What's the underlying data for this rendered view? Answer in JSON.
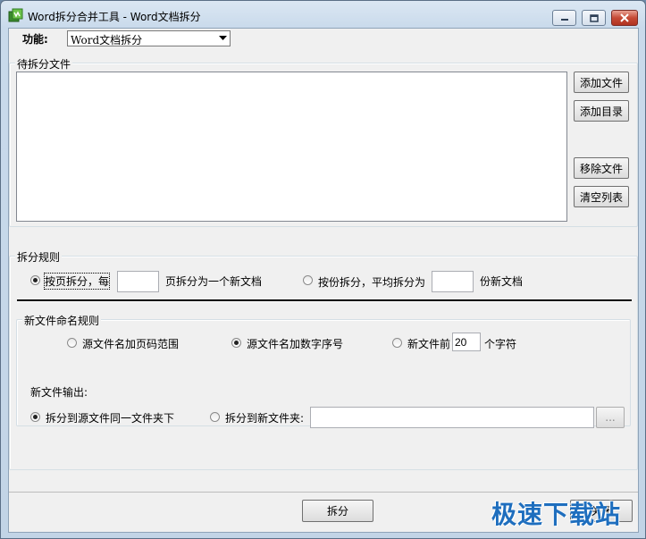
{
  "window": {
    "title": "Word拆分合并工具 - Word文档拆分"
  },
  "function_bar": {
    "label": "功能:",
    "selected": "Word文档拆分"
  },
  "files_group": {
    "title": "待拆分文件",
    "buttons": {
      "add_file": "添加文件",
      "add_dir": "添加目录",
      "remove_file": "移除文件",
      "clear_list": "清空列表"
    }
  },
  "split_rules": {
    "title": "拆分规则",
    "by_page_label": "按页拆分，每",
    "by_page_value": "",
    "by_page_suffix": "页拆分为一个新文档",
    "by_count_label": "按份拆分，平均拆分为",
    "by_count_value": "",
    "by_count_suffix": "份新文档",
    "selected": "by_page"
  },
  "naming": {
    "title": "新文件命名规则",
    "opt_page_range": "源文件名加页码范围",
    "opt_number": "源文件名加数字序号",
    "opt_prefix": "新文件前",
    "prefix_value": "20",
    "prefix_suffix": "个字符",
    "selected": "opt_number"
  },
  "output": {
    "label": "新文件输出:",
    "opt_same_folder": "拆分到源文件同一文件夹下",
    "opt_new_folder": "拆分到新文件夹:",
    "folder_value": "",
    "browse_label": "...",
    "selected": "opt_same_folder"
  },
  "footer": {
    "split_button": "拆分",
    "close_button": "关闭"
  },
  "watermark": "极速下载站",
  "colors": {
    "title_gradient": "#c9daeb",
    "close_button": "#c64a36",
    "client_bg": "#f0f0f0",
    "watermark": "#1e6ebe"
  }
}
